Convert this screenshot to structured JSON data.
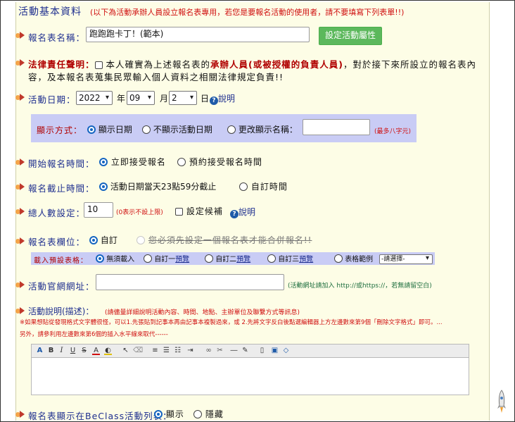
{
  "section_title": "活動基本資料",
  "section_note": "(以下為活動承辦人員設立報名表專用，若您是要報名活動的使用者，請不要填寫下列表單!!)",
  "form_name": {
    "label": "報名表名稱：",
    "value": "跑跑跑卡丁！(範本)",
    "settings_button": "設定活動屬性"
  },
  "legal": {
    "label": "法律責任聲明：",
    "text1": "本人確實為上述報名表的",
    "highlight": "承辦人員(或被授權的負責人員)",
    "text2": "，對於接下來所設立的報名表內",
    "line2": "容，及本報名表蒐集民眾輸入個人資料之相關法律規定負責!!"
  },
  "event_date": {
    "label": "活動日期：",
    "year": "2022",
    "year_unit": "年",
    "month": "09",
    "month_unit": "月",
    "day": "2",
    "day_unit": "日",
    "help_label": "說明"
  },
  "display_mode": {
    "label": "顯示方式：",
    "options": [
      "顯示日期",
      "不顯示活動日期",
      "更改顯示名稱："
    ],
    "selected": 0,
    "custom_name": "",
    "hint": "(最多八字元)"
  },
  "start_time": {
    "label": "開始報名時間：",
    "options": [
      "立即接受報名",
      "預約接受報名時間"
    ],
    "selected": 0
  },
  "end_time": {
    "label": "報名截止時間：",
    "options": [
      "活動日期當天23點59分截止",
      "自訂時間"
    ],
    "selected": 0
  },
  "total": {
    "label": "總人數設定：",
    "value": "10",
    "hint": "(0表示不設上限)",
    "waitlist_label": "設定候補",
    "help_label": "說明"
  },
  "fields": {
    "label": "報名表欄位：",
    "custom_label": "自訂",
    "disabled_text": "您必須先設定一個報名表才能合併報名!!"
  },
  "preset": {
    "label": "載入預設表格：",
    "options": [
      {
        "text": "無須載入",
        "link": ""
      },
      {
        "text": "自訂一",
        "link": "預覽"
      },
      {
        "text": "自訂二",
        "link": "預覽"
      },
      {
        "text": "自訂三",
        "link": "預覽"
      }
    ],
    "selected": 0,
    "sample_label": "表格範例",
    "sample_select": "-請選擇-"
  },
  "website": {
    "label": "活動官網網址：",
    "value": "",
    "hint": "(活動網址請加入 http://或https://，若無請留空白)"
  },
  "description": {
    "label": "活動說明(描述)：",
    "label_note": "(請儘量詳細說明活動內容、時間、地點、主辦單位及聯繫方式等訊息)",
    "note1": "※如果想貼從發現格式文字體很怪，可以1.先張貼到記事本再由記事本複製過來，或 2.先將文字反白後點選編輯器上方左邊數來第9個「刪除文字格式」即可。...",
    "note2": "另外，請參利用左邊數來第6個的插入水平線來取代------"
  },
  "toolbar_icons": [
    "font-icon",
    "bold-icon",
    "italic-icon",
    "underline-icon",
    "strike-icon",
    "text-color-icon",
    "bg-color-icon",
    "cursor-icon",
    "eraser-icon",
    "align-left-icon",
    "ordered-list-icon",
    "unordered-list-icon",
    "indent-icon",
    "link-icon",
    "unlink-icon",
    "hr-icon",
    "edit-icon",
    "preview-icon",
    "image-icon",
    "source-icon"
  ],
  "show_in_list": {
    "label": "報名表顯示在BeClass活動列表：",
    "options": [
      "顯示",
      "隱藏"
    ],
    "selected": 0
  },
  "colors": {
    "panel_bg": "#fdfde6",
    "label_blue": "#1f2f8f",
    "note_red": "#d01010",
    "button_green": "#5cb85c",
    "highlight_box": "#c9ccf5"
  }
}
